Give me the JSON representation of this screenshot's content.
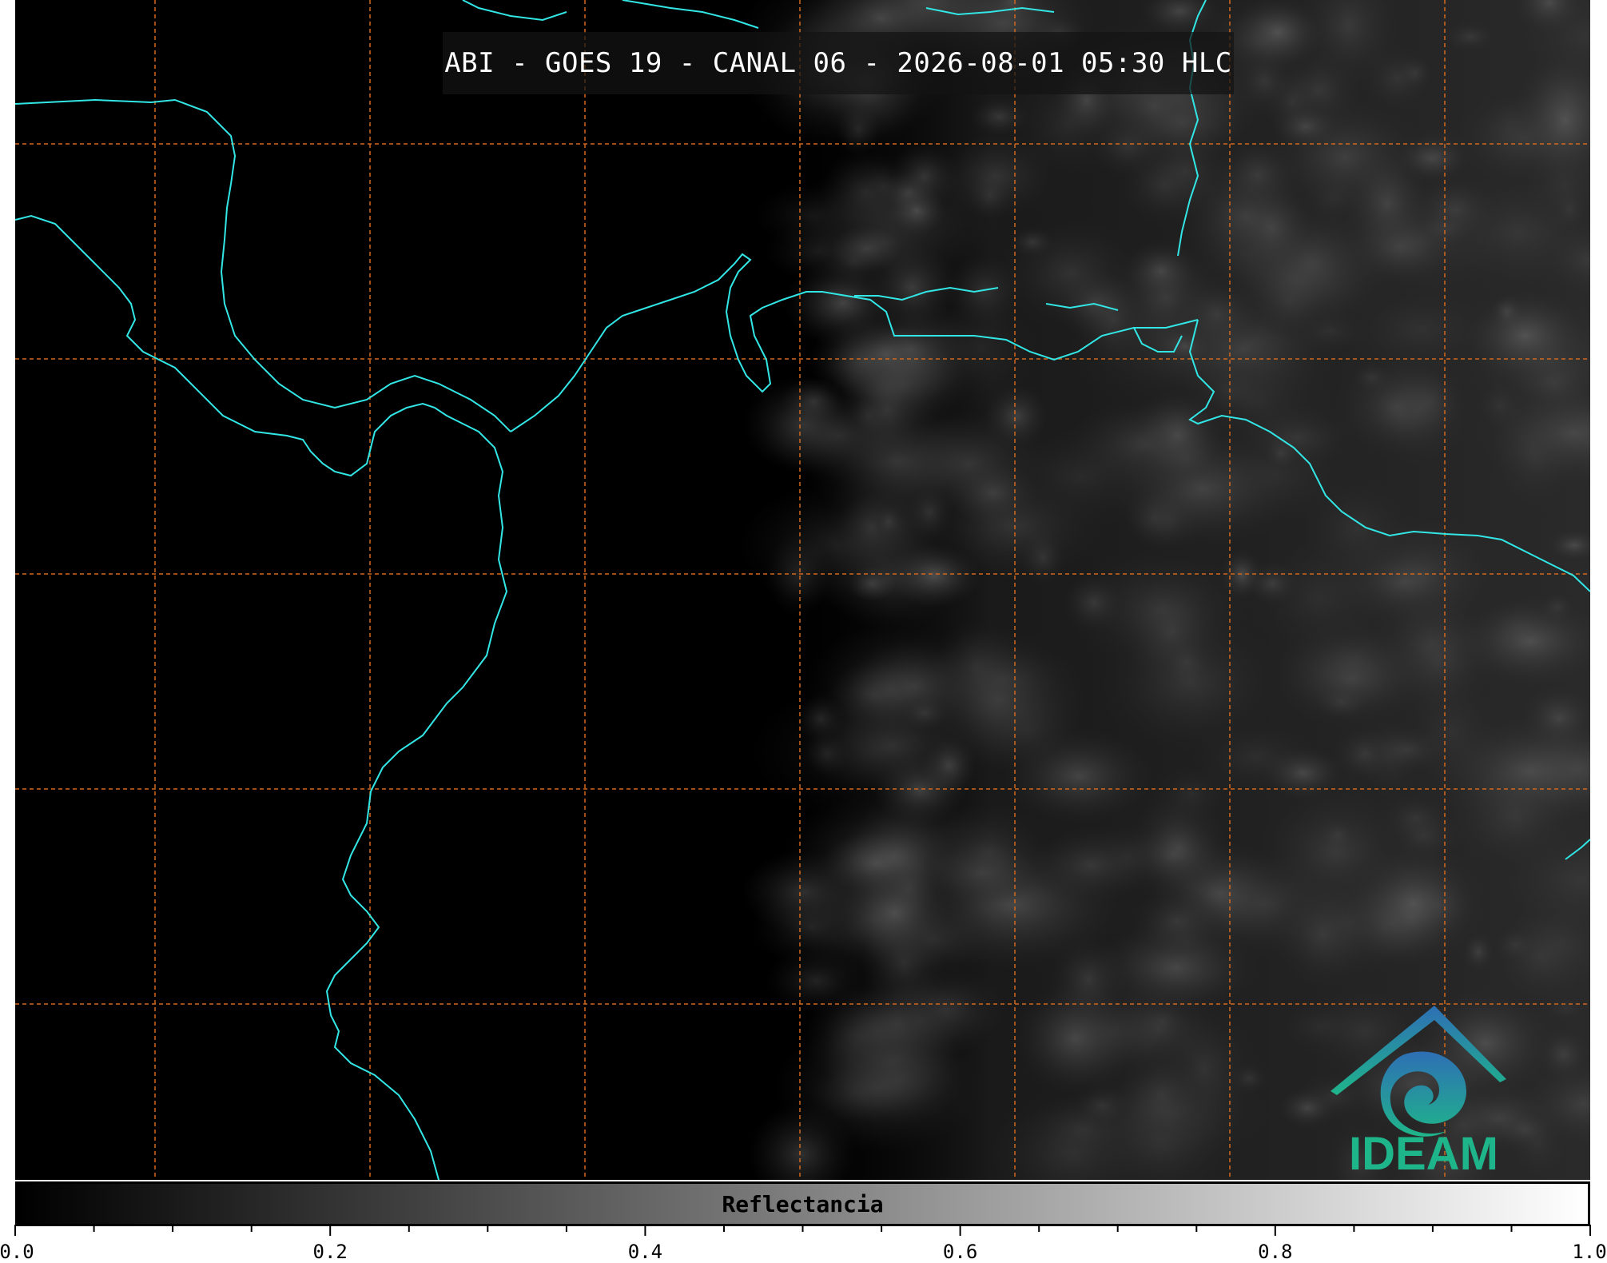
{
  "title": "ABI - GOES 19 - CANAL 06 - 2026-08-01 05:30 HLC",
  "colorbar": {
    "label": "Reflectancia",
    "min": 0.0,
    "max": 1.0,
    "ticks": [
      "0.0",
      "0.2",
      "0.4",
      "0.6",
      "0.8",
      "1.0"
    ],
    "tick_values": [
      0.0,
      0.2,
      0.4,
      0.6,
      0.8,
      1.0
    ],
    "minor_step": 0.05
  },
  "logo": {
    "text": "IDEAM",
    "color_top": "#2e6fb5",
    "color_bottom": "#1fb58a"
  },
  "colors": {
    "coastline": "#33e6e6",
    "gridlines": "#d2691e",
    "background": "#000000"
  },
  "icons": [
    "ideam-logo-icon"
  ]
}
